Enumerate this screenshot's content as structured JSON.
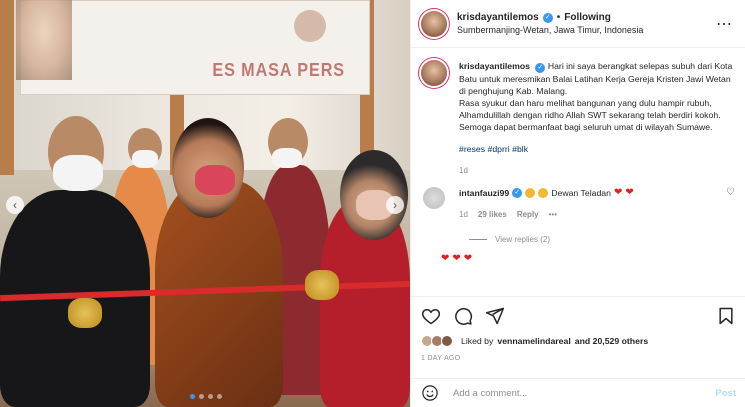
{
  "header": {
    "username": "krisdayantilemos",
    "follow_sep": "•",
    "follow_label": "Following",
    "location": "Sumbermanjing-Wetan, Jawa Timur, Indonesia"
  },
  "photo": {
    "banner_text": "ES MASA PERS"
  },
  "caption": {
    "username": "krisdayantilemos",
    "text": "Hari ini saya berangkat selepas subuh dari Kota Batu untuk meresmikan Balai Latihan Kerja Gereja Kristen Jawi Wetan di penghujung Kab. Malang.",
    "text2": "Rasa syukur dan haru melihat bangunan yang dulu hampir rubuh, Alhamdulillah dengan ridho Allah SWT sekarang telah berdiri kokoh. Semoga dapat bermanfaat bagi seluruh umat di wilayah Sumawe.",
    "tags": "#reses #dprri #blk",
    "age": "1d"
  },
  "comment": {
    "username": "intanfauzi99",
    "text": "Dewan Teladan",
    "age": "1d",
    "likes": "29 likes",
    "reply_label": "Reply",
    "more": "•••",
    "view_replies": "View replies (2)"
  },
  "likes": {
    "and_label": "Liked by",
    "user": "vennamelindareal",
    "rest": "and 20,529 others"
  },
  "timestamp": "1 DAY AGO",
  "add_comment": {
    "placeholder": "Add a comment...",
    "post_label": "Post"
  },
  "colors": {
    "accent": "#3897f0",
    "heart": "#e02020",
    "post_disabled": "#b2dffc"
  }
}
